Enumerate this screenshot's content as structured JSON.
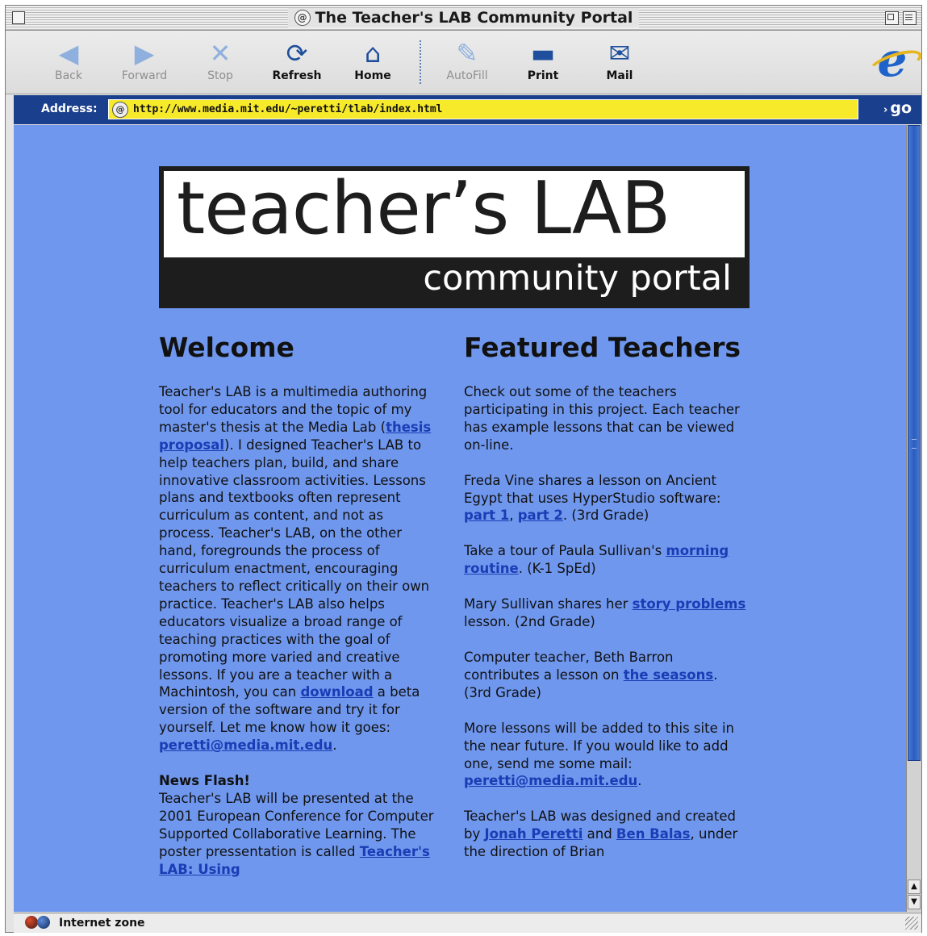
{
  "window": {
    "title": "The Teacher's LAB Community Portal"
  },
  "toolbar": {
    "buttons": [
      {
        "label": "Back",
        "icon": "back-arrow-icon",
        "enabled": false
      },
      {
        "label": "Forward",
        "icon": "forward-arrow-icon",
        "enabled": false
      },
      {
        "label": "Stop",
        "icon": "stop-x-icon",
        "enabled": false
      },
      {
        "label": "Refresh",
        "icon": "refresh-icon",
        "enabled": true
      },
      {
        "label": "Home",
        "icon": "home-icon",
        "enabled": true
      },
      {
        "label": "AutoFill",
        "icon": "autofill-pen-icon",
        "enabled": false
      },
      {
        "label": "Print",
        "icon": "printer-icon",
        "enabled": true
      },
      {
        "label": "Mail",
        "icon": "mail-icon",
        "enabled": true
      }
    ],
    "brand_icon": "internet-explorer-logo-icon"
  },
  "address": {
    "label": "Address:",
    "url": "http://www.media.mit.edu/~peretti/tlab/index.html",
    "go_label": "go"
  },
  "banner": {
    "title": "teacher’s LAB",
    "subtitle": "community portal"
  },
  "welcome": {
    "heading": "Welcome",
    "p1_a": "Teacher's LAB is a multimedia authoring tool for educators and the topic of my master's thesis at the Media Lab (",
    "p1_link_thesis": "thesis proposal",
    "p1_b": "). I designed Teacher's LAB to help teachers plan, build, and share innovative classroom activities. Lessons plans and textbooks often represent curriculum as content, and not as process. Teacher's LAB, on the other hand, foregrounds the process of curriculum enactment, encouraging teachers to reflect critically on their own practice. Teacher's LAB also helps educators visualize a broad range of teaching practices with the goal of promoting more varied and creative lessons. If you are a teacher with a Machintosh, you can ",
    "p1_link_download": "download",
    "p1_c": " a beta version of the software and try it for yourself. Let me know how it goes: ",
    "p1_link_email": "peretti@media.mit.edu",
    "p1_d": ".",
    "news_heading": "News Flash!",
    "news_a": "Teacher's LAB will be presented at the 2001 European Conference for Computer Supported Collaborative Learning. The poster pressentation is called ",
    "news_link": "Teacher's LAB: Using"
  },
  "featured": {
    "heading": "Featured Teachers",
    "intro": "Check out some of the teachers participating in this project. Each teacher has example lessons that can be viewed on-line.",
    "freda_a": "Freda Vine shares a lesson on Ancient Egypt that uses HyperStudio software: ",
    "freda_link1": "part 1",
    "freda_sep": ", ",
    "freda_link2": "part 2",
    "freda_b": ". (3rd Grade)",
    "paula_a": "Take a tour of Paula Sullivan's ",
    "paula_link": "morning routine",
    "paula_b": ". (K-1 SpEd)",
    "mary_a": "Mary Sullivan shares her ",
    "mary_link": "story problems",
    "mary_b": " lesson. (2nd Grade)",
    "beth_a": "Computer teacher, Beth Barron contributes a lesson on ",
    "beth_link": "the seasons",
    "beth_b": ". (3rd Grade)",
    "more_a": "More lessons will be added to this site in the near future. If you would like to add one, send me some mail: ",
    "more_link": "peretti@media.mit.edu",
    "more_b": ".",
    "credit_a": "Teacher's LAB was designed and created by ",
    "credit_link1": "Jonah Peretti",
    "credit_mid": " and ",
    "credit_link2": "Ben Balas",
    "credit_b": ", under the direction of Brian"
  },
  "status": {
    "zone": "Internet zone"
  }
}
